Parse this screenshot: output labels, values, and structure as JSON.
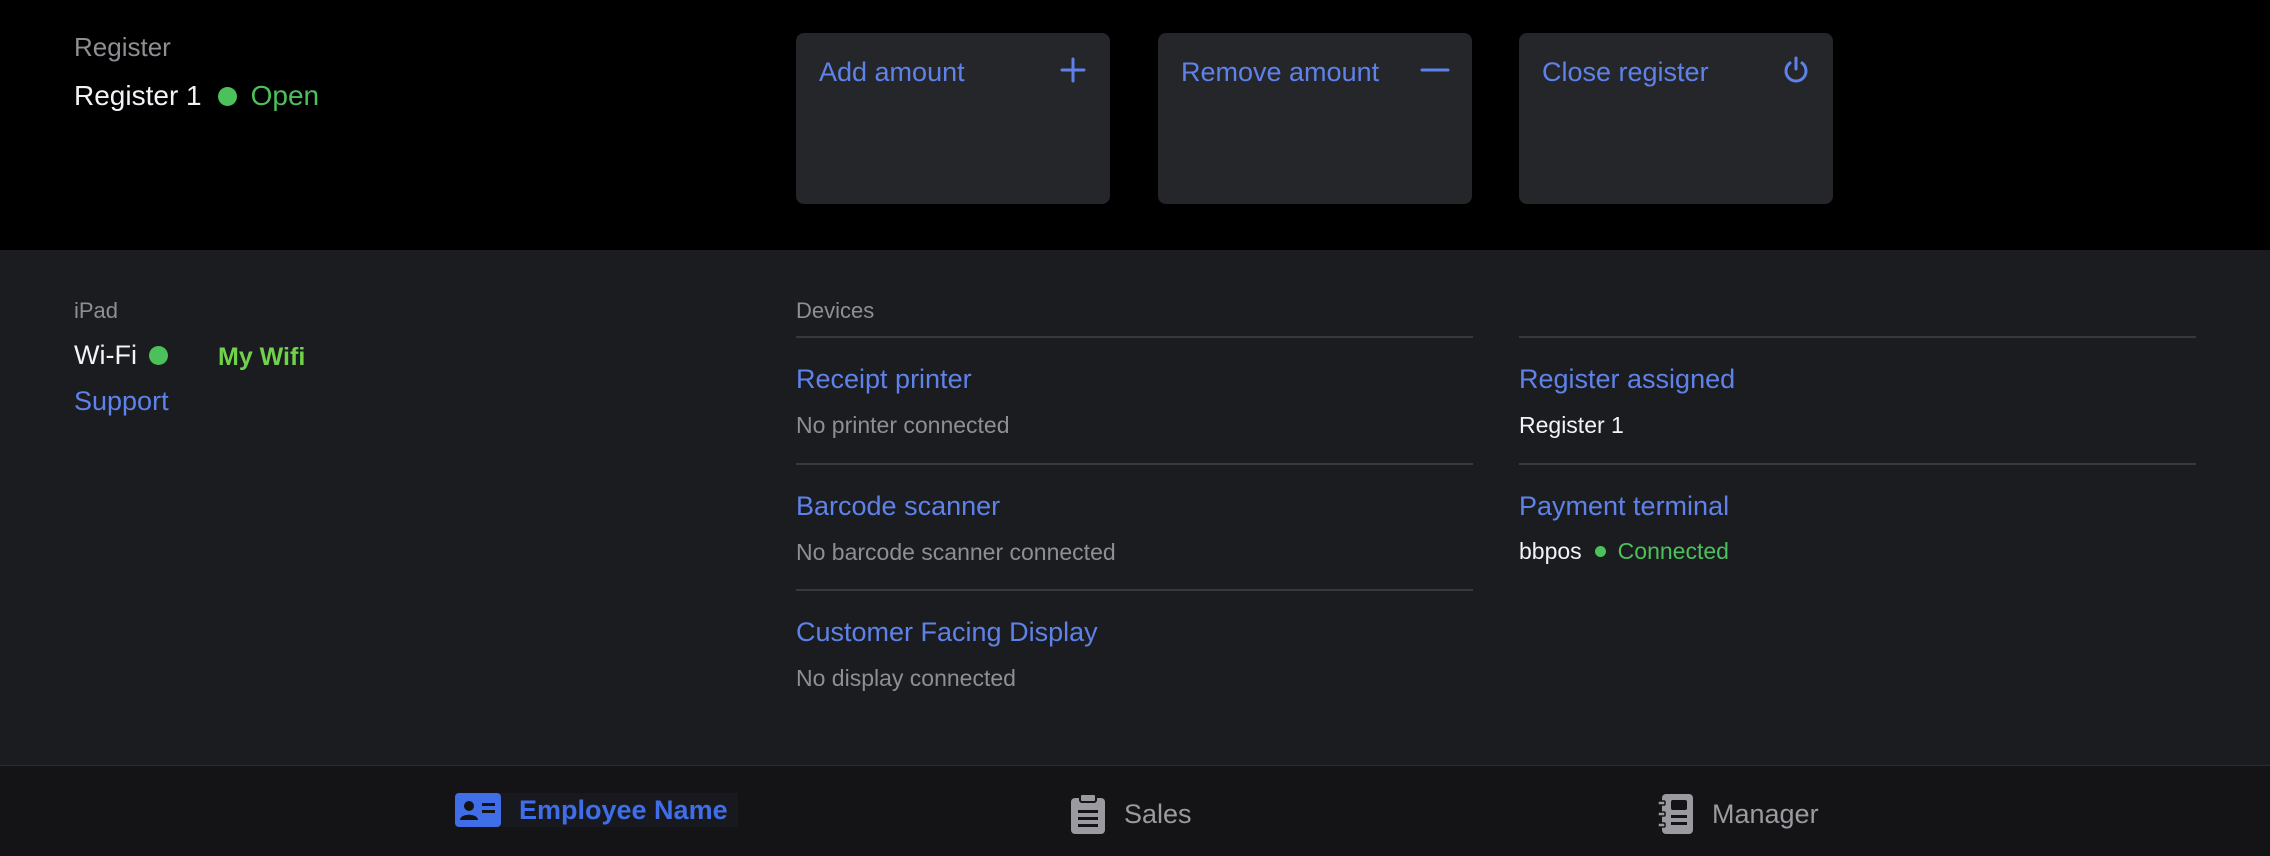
{
  "register": {
    "section_label": "Register",
    "name": "Register 1",
    "status": "Open"
  },
  "actions": {
    "add_label": "Add amount",
    "remove_label": "Remove amount",
    "close_label": "Close register"
  },
  "ipad": {
    "section_label": "iPad",
    "wifi_label": "Wi-Fi",
    "wifi_network": "My Wifi",
    "support_label": "Support"
  },
  "devices": {
    "section_label": "Devices",
    "receipt_printer": {
      "title": "Receipt printer",
      "status": "No printer connected"
    },
    "barcode_scanner": {
      "title": "Barcode scanner",
      "status": "No barcode scanner connected"
    },
    "customer_display": {
      "title": "Customer Facing Display",
      "status": "No display connected"
    },
    "register_assigned": {
      "title": "Register assigned",
      "value": "Register 1"
    },
    "payment_terminal": {
      "title": "Payment terminal",
      "device": "bbpos",
      "status": "Connected"
    }
  },
  "tabbar": {
    "employee_label": "Employee Name",
    "sales_label": "Sales",
    "manager_label": "Manager"
  },
  "colors": {
    "accent_blue": "#5f82ea",
    "status_green": "#4cc05a",
    "wifi_green": "#6fd24a",
    "active_tab_blue": "#3f6ee8"
  },
  "icons": {
    "add": "plus-icon",
    "remove": "minus-icon",
    "close": "power-icon",
    "employee": "id-card-icon",
    "sales": "clipboard-icon",
    "manager": "directory-book-icon"
  }
}
